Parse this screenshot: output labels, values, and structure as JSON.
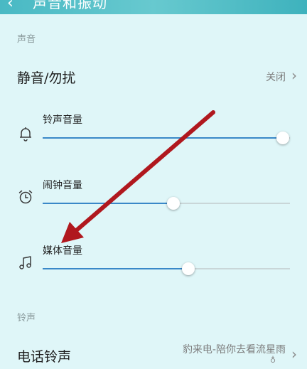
{
  "header": {
    "back_icon": "back-arrow-icon",
    "title": "声音和振动"
  },
  "sections": {
    "sound_label": "声音",
    "ringtone_label": "铃声"
  },
  "silent": {
    "label": "静音/勿扰",
    "value": "关闭"
  },
  "volumes": [
    {
      "label": "铃声音量",
      "icon": "bell-icon",
      "level": 0.97
    },
    {
      "label": "闹钟音量",
      "icon": "alarm-clock-icon",
      "level": 0.53
    },
    {
      "label": "媒体音量",
      "icon": "music-note-icon",
      "level": 0.59
    }
  ],
  "phone_ringtone": {
    "label": "电话铃声",
    "value": "豹来电-陪你去看流星雨"
  },
  "colors": {
    "background": "#dff6f8",
    "header": "#49b9c4",
    "slider_fill": "#3a88c8",
    "annotation_arrow": "#b0181e"
  }
}
